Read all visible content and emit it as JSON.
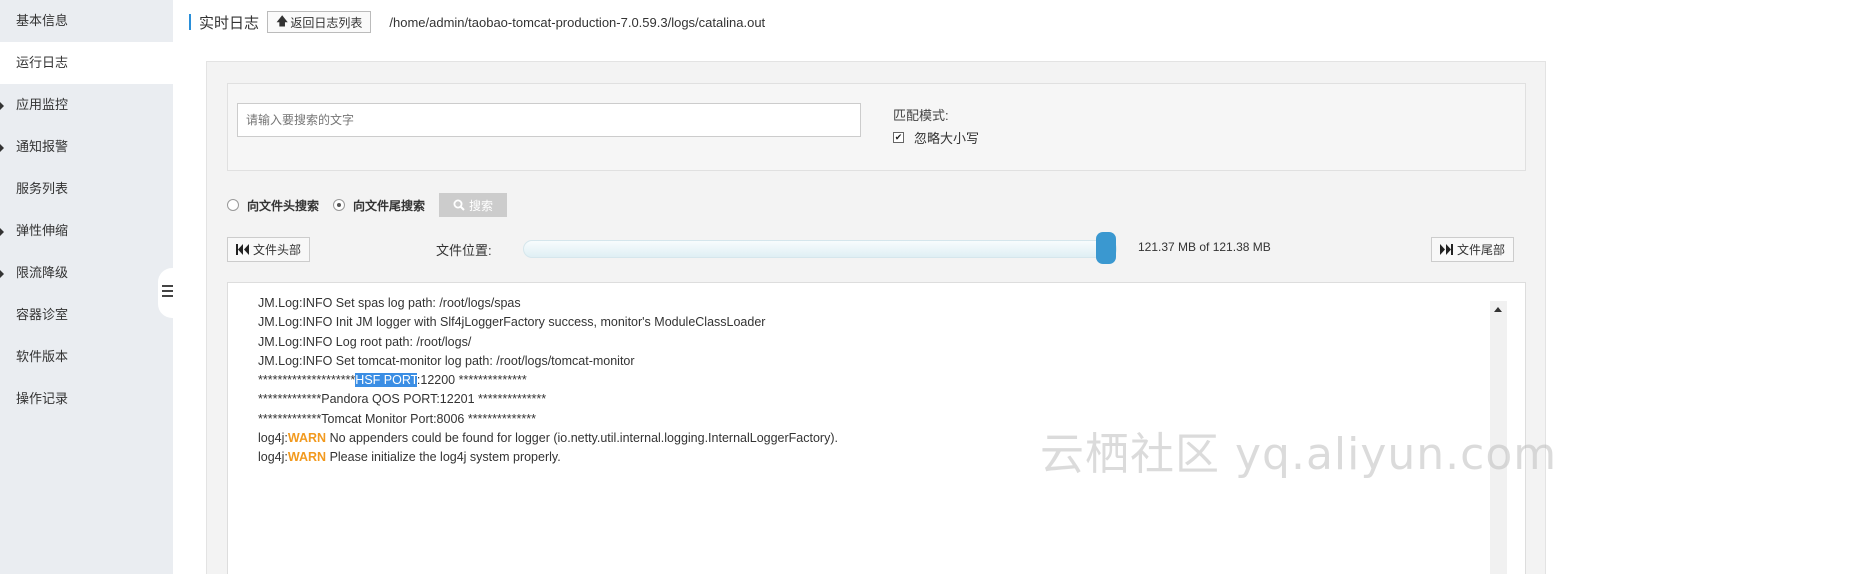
{
  "sidebar": {
    "items": [
      {
        "label": "基本信息",
        "caret": false,
        "active": false
      },
      {
        "label": "运行日志",
        "caret": false,
        "active": true
      },
      {
        "label": "应用监控",
        "caret": true,
        "active": false
      },
      {
        "label": "通知报警",
        "caret": true,
        "active": false
      },
      {
        "label": "服务列表",
        "caret": false,
        "active": false
      },
      {
        "label": "弹性伸缩",
        "caret": true,
        "active": false
      },
      {
        "label": "限流降级",
        "caret": true,
        "active": false
      },
      {
        "label": "容器诊室",
        "caret": false,
        "active": false
      },
      {
        "label": "软件版本",
        "caret": false,
        "active": false
      },
      {
        "label": "操作记录",
        "caret": false,
        "active": false
      }
    ]
  },
  "header": {
    "title": "实时日志",
    "back_label": "返回日志列表",
    "path": "/home/admin/taobao-tomcat-production-7.0.59.3/logs/catalina.out"
  },
  "search": {
    "placeholder": "请输入要搜索的文字",
    "match_mode_label": "匹配模式:",
    "ignore_case_label": "忽略大小写",
    "ignore_case_checked": true,
    "radio_head_label": "向文件头搜索",
    "radio_tail_label": "向文件尾搜索",
    "selected_direction": "tail",
    "search_button_label": "搜索"
  },
  "file_nav": {
    "head_button_label": "文件头部",
    "tail_button_label": "文件尾部",
    "position_label": "文件位置:",
    "position_fraction": 0.9999,
    "size_text": "121.37 MB of 121.38 MB"
  },
  "log": {
    "lines": [
      {
        "parts": [
          {
            "t": "JM.Log:INFO Set spas log path: /root/logs/spas"
          }
        ]
      },
      {
        "parts": [
          {
            "t": "JM.Log:INFO Init JM logger with Slf4jLoggerFactory success, monitor's ModuleClassLoader"
          }
        ]
      },
      {
        "parts": [
          {
            "t": "JM.Log:INFO Log root path: /root/logs/"
          }
        ]
      },
      {
        "parts": [
          {
            "t": "JM.Log:INFO Set tomcat-monitor log path: /root/logs/tomcat-monitor"
          }
        ]
      },
      {
        "parts": [
          {
            "t": "********************"
          },
          {
            "t": "HSF PORT",
            "cls": "hl"
          },
          {
            "t": ":12200 **************"
          }
        ]
      },
      {
        "parts": [
          {
            "t": "*************Pandora QOS PORT:12201 **************"
          }
        ]
      },
      {
        "parts": [
          {
            "t": "*************Tomcat Monitor Port:8006 **************"
          }
        ]
      },
      {
        "parts": [
          {
            "t": "log4j:"
          },
          {
            "t": "WARN",
            "cls": "warn"
          },
          {
            "t": " No appenders could be found for logger (io.netty.util.internal.logging.InternalLoggerFactory)."
          }
        ]
      },
      {
        "parts": [
          {
            "t": "log4j:"
          },
          {
            "t": "WARN",
            "cls": "warn"
          },
          {
            "t": " Please initialize the log4j system properly."
          }
        ]
      }
    ]
  },
  "watermark": "云栖社区 yq.aliyun.com",
  "colors": {
    "accent": "#2a8fd9",
    "slider_handle": "#3a98d0",
    "highlight": "#3b8ee4",
    "warn": "#f29a1f"
  }
}
